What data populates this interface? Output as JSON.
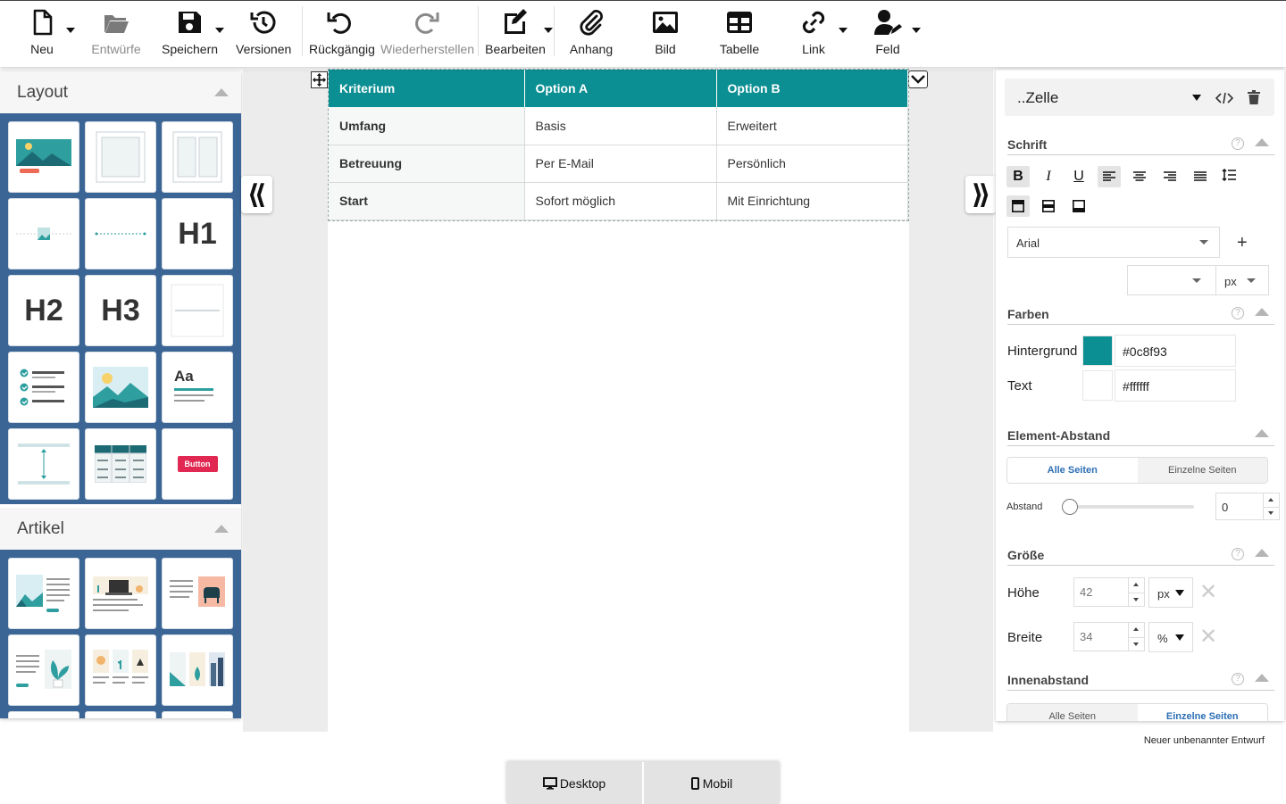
{
  "toolbar": {
    "new": "Neu",
    "drafts": "Entwürfe",
    "save": "Speichern",
    "versions": "Versionen",
    "undo": "Rückgängig",
    "redo": "Wiederherstellen",
    "edit": "Bearbeiten",
    "attachment": "Anhang",
    "image": "Bild",
    "table": "Tabelle",
    "link": "Link",
    "field": "Feld"
  },
  "left_panel": {
    "layout_title": "Layout",
    "layout_tiles": [
      {
        "icon": "image-text-block-icon"
      },
      {
        "icon": "bordered-box-icon"
      },
      {
        "icon": "two-column-box-icon"
      },
      {
        "icon": "centered-image-icon"
      },
      {
        "icon": "divider-dotted-icon"
      },
      {
        "icon": "heading-1-icon",
        "label": "H1"
      },
      {
        "icon": "heading-2-icon",
        "label": "H2"
      },
      {
        "icon": "heading-3-icon",
        "label": "H3"
      },
      {
        "icon": "horizontal-rule-icon"
      },
      {
        "icon": "checklist-icon"
      },
      {
        "icon": "landscape-image-icon"
      },
      {
        "icon": "text-style-icon",
        "label": "Aa"
      },
      {
        "icon": "spacer-icon"
      },
      {
        "icon": "table-icon"
      },
      {
        "icon": "button-element-icon",
        "label": "Button"
      }
    ],
    "articles_title": "Artikel",
    "article_tiles": [
      {
        "icon": "article-image-left-icon"
      },
      {
        "icon": "article-laptop-icon"
      },
      {
        "icon": "article-chair-right-icon"
      },
      {
        "icon": "article-plant-right-icon"
      },
      {
        "icon": "article-three-columns-icon"
      },
      {
        "icon": "article-three-images-icon"
      }
    ]
  },
  "table": {
    "headers": [
      "Kriterium",
      "Option A",
      "Option B"
    ],
    "rows": [
      [
        "Umfang",
        "Basis",
        "Erweitert"
      ],
      [
        "Betreuung",
        "Per E-Mail",
        "Persönlich"
      ],
      [
        "Start",
        "Sofort möglich",
        "Mit Einrichtung"
      ]
    ],
    "header_color": "#0c8f93"
  },
  "right_panel": {
    "element_selector": "..Zelle",
    "font_section": "Schrift",
    "font_family": "Arial",
    "font_size": "",
    "font_unit": "px",
    "colors_section": "Farben",
    "background_label": "Hintergrund",
    "background_value": "#0c8f93",
    "text_label": "Text",
    "text_value": "#ffffff",
    "spacing_section": "Element-Abstand",
    "all_pages": "Alle Seiten",
    "single_pages": "Einzelne Seiten",
    "spacing_label": "Abstand",
    "spacing_value": "0",
    "size_section": "Größe",
    "height_label": "Höhe",
    "height_value": "42",
    "height_unit": "px",
    "width_label": "Breite",
    "width_value": "34",
    "width_unit": "%",
    "padding_section": "Innenabstand",
    "padding_all_pages": "Alle Seiten",
    "padding_single_pages": "Einzelne Seiten"
  },
  "footer": {
    "draft_name": "Neuer unbenannter Entwurf",
    "desktop": "Desktop",
    "mobile": "Mobil"
  }
}
